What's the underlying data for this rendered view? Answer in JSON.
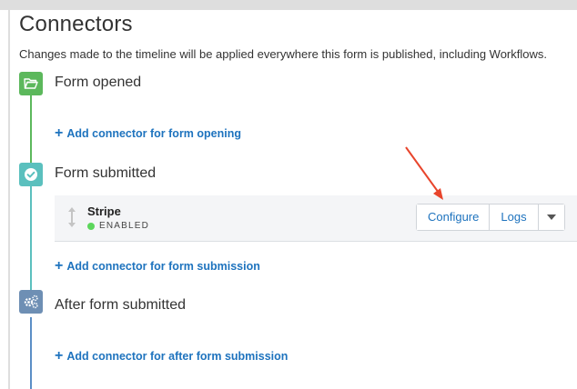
{
  "page": {
    "title": "Connectors",
    "description": "Changes made to the timeline will be applied everywhere this form is published, including Workflows."
  },
  "steps": [
    {
      "label": "Form opened",
      "icon": "folder-open-icon",
      "color": "#5cb85c",
      "add_link": "Add connector for form opening"
    },
    {
      "label": "Form submitted",
      "icon": "check-circle-icon",
      "color": "#5bc0be",
      "add_link": "Add connector for form submission"
    },
    {
      "label": "After form submitted",
      "icon": "gears-icon",
      "color": "#6e8fb4",
      "add_link": "Add connector for after form submission"
    }
  ],
  "connector": {
    "name": "Stripe",
    "status": "ENABLED",
    "status_color": "#5cd65c",
    "configure_label": "Configure",
    "logs_label": "Logs"
  },
  "annotation": {
    "arrow_color": "#e8452c"
  },
  "colors": {
    "link": "#1e73be"
  }
}
